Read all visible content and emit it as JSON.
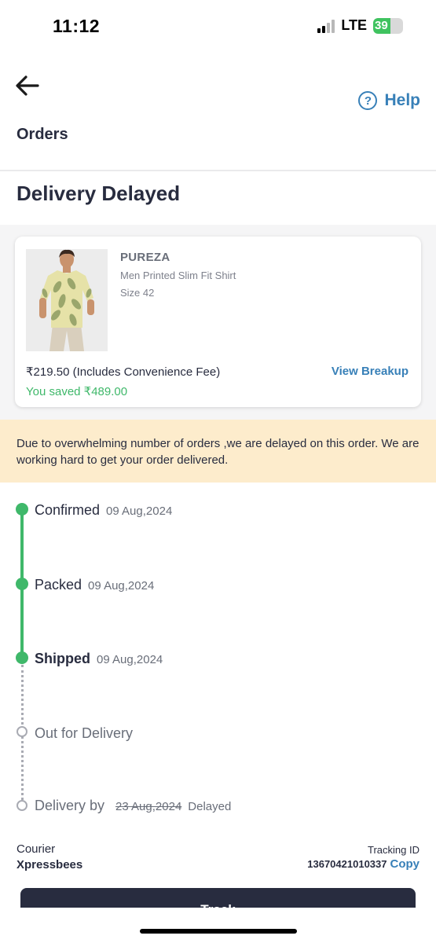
{
  "status_bar": {
    "time": "11:12",
    "network": "LTE",
    "battery_percent": "39",
    "battery_level": 0.39,
    "battery_color": "#3fc35f"
  },
  "header": {
    "back_icon": "back-arrow-icon",
    "help_label": "Help",
    "help_icon": "question-circle-icon",
    "title": "Orders"
  },
  "page_title": "Delivery Delayed",
  "product": {
    "brand": "PUREZA",
    "description": "Men Printed Slim Fit Shirt",
    "size": "Size 42",
    "price": "₹219.50 (Includes Convenience Fee)",
    "saved": "You saved ₹489.00",
    "breakup_link": "View Breakup"
  },
  "notice": {
    "text": "Due to overwhelming number of orders ,we are delayed on this order. We are working hard to get your order delivered.",
    "background": "#fdeccc"
  },
  "timeline": {
    "steps": [
      {
        "label": "Confirmed",
        "date": "09 Aug,2024",
        "done": true
      },
      {
        "label": "Packed",
        "date": "09 Aug,2024",
        "done": true
      },
      {
        "label": "Shipped",
        "date": "09 Aug,2024",
        "done": true
      },
      {
        "label": "Out for Delivery",
        "date": "",
        "done": false
      },
      {
        "label": "Delivery by",
        "date": "23 Aug,2024",
        "status": "Delayed",
        "done": false
      }
    ],
    "done_color": "#3fb86a",
    "pending_color": "#a9abb3"
  },
  "courier": {
    "label": "Courier",
    "name": "Xpressbees",
    "tracking_label": "Tracking ID",
    "tracking_id": "13670421010337",
    "copy_label": "Copy"
  },
  "bottom_button": {
    "label": "Track"
  }
}
